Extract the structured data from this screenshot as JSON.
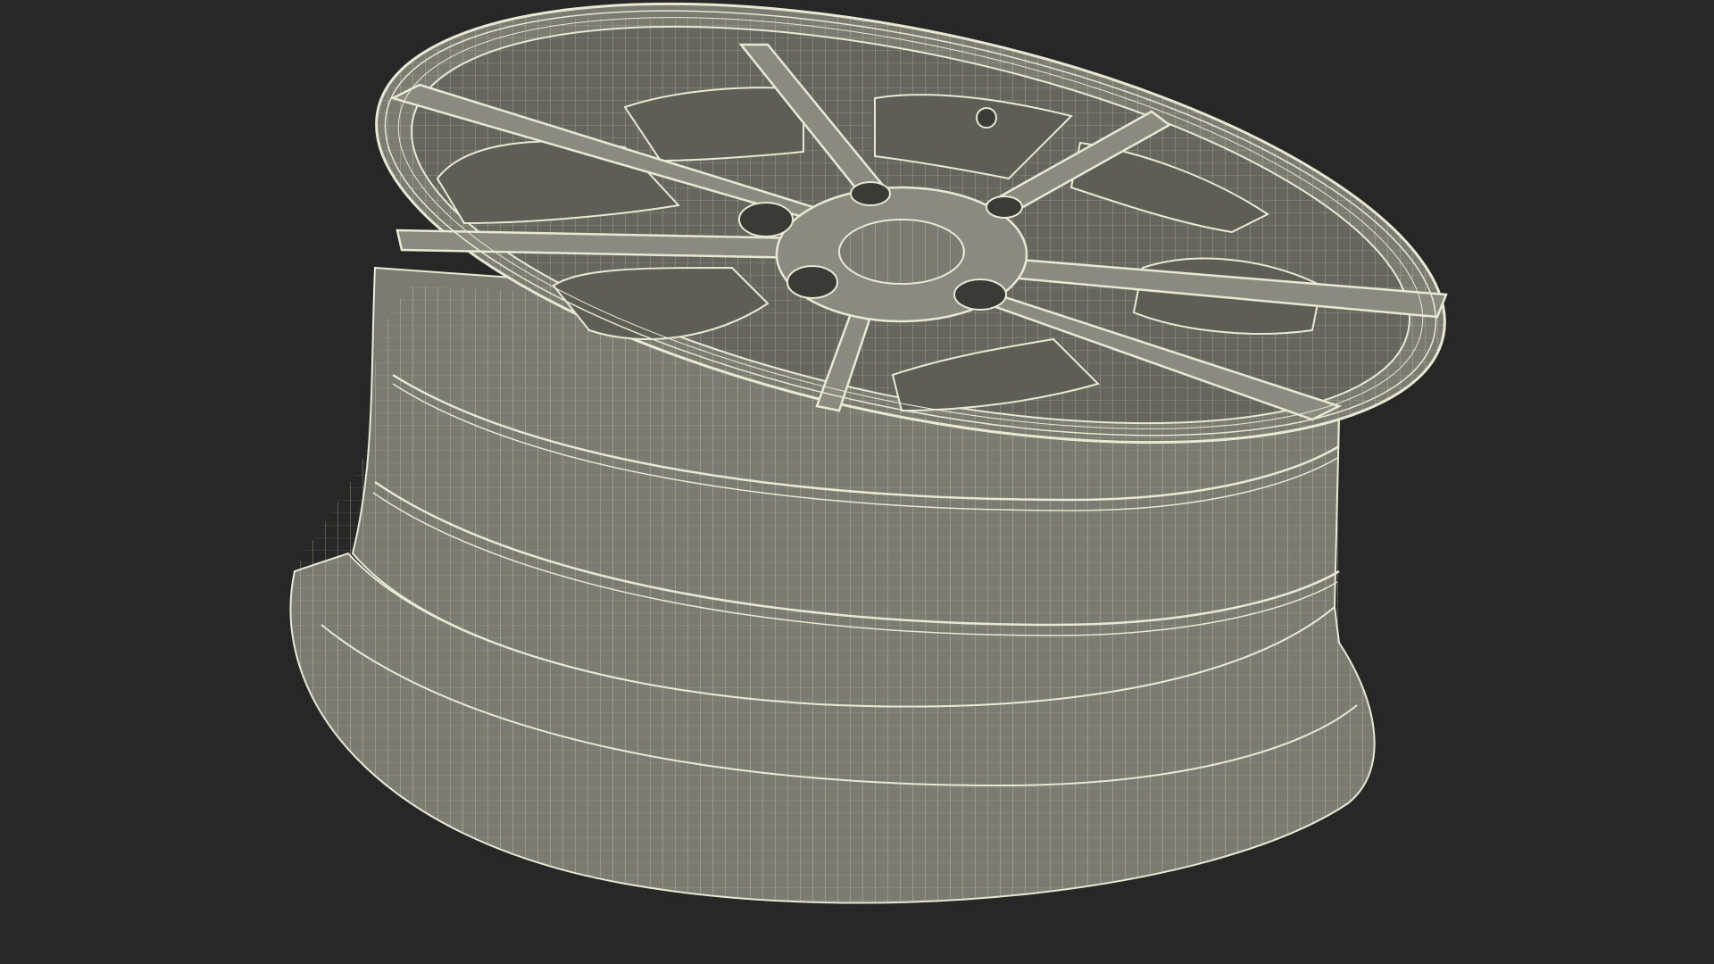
{
  "scene": {
    "subject": "wheel-rim",
    "render_style": "wireframe",
    "spoke_count": 7,
    "lug_hole_count": 5,
    "colors": {
      "background": "#272727",
      "surface": "#7b7b71",
      "surface_dark": "#66665e",
      "surface_light": "#8a8a80",
      "wire": "#e9e8d3"
    }
  }
}
